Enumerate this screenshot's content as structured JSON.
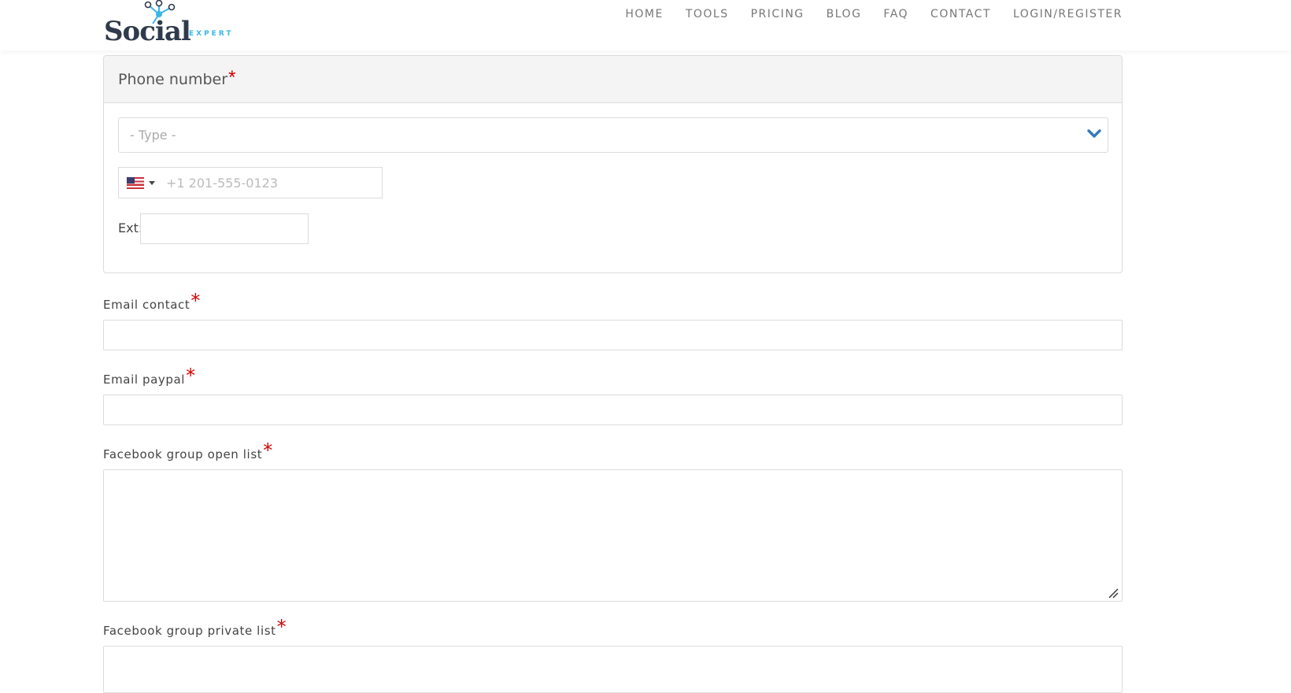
{
  "logo": {
    "name": "Social",
    "sub": "EXPERT"
  },
  "nav": [
    "HOME",
    "TOOLS",
    "PRICING",
    "BLOG",
    "FAQ",
    "CONTACT",
    "LOGIN/REGISTER"
  ],
  "phone_panel": {
    "title": "Phone number",
    "required_mark": "*",
    "type_select": {
      "value": "- Type -"
    },
    "phone_input": {
      "placeholder": "+1 201-555-0123",
      "country": "United States"
    },
    "ext_label": "Ext:"
  },
  "fields": {
    "email_contact": {
      "label": "Email contact",
      "required_mark": "*"
    },
    "email_paypal": {
      "label": "Email paypal",
      "required_mark": "*"
    },
    "fb_open": {
      "label": "Facebook group open list",
      "required_mark": "*"
    },
    "fb_private": {
      "label": "Facebook group private list",
      "required_mark": "*"
    }
  },
  "colors": {
    "required": "#d40000",
    "accent": "#337ab7",
    "logo_blue": "#39b6e6",
    "logo_dark": "#2f3b4c"
  }
}
